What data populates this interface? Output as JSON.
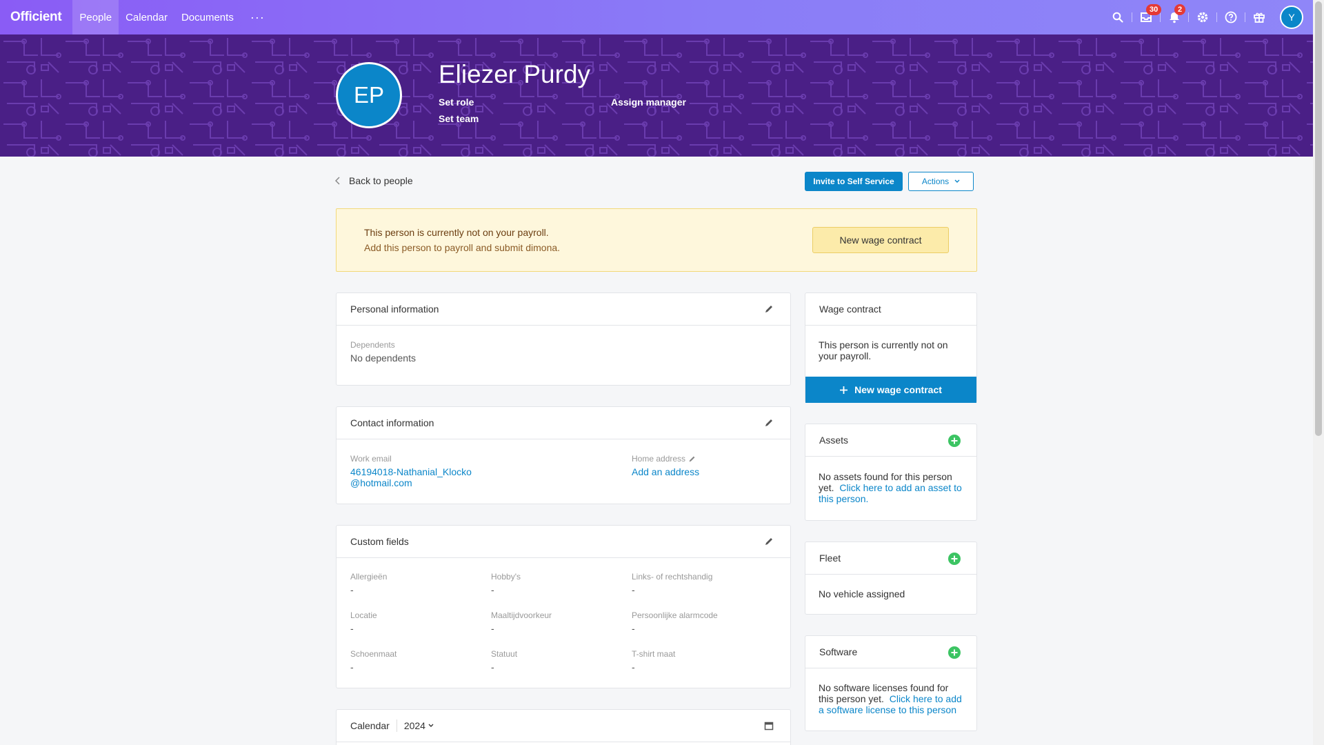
{
  "nav": {
    "logo": "Officient",
    "items": [
      {
        "label": "People",
        "active": true
      },
      {
        "label": "Calendar",
        "active": false
      },
      {
        "label": "Documents",
        "active": false
      }
    ],
    "more": "···",
    "icons": [
      "search-icon",
      "inbox-icon",
      "bell-icon",
      "gear-icon",
      "help-icon",
      "gift-icon"
    ],
    "inbox_badge": "30",
    "bell_badge": "2",
    "user_initial": "Y"
  },
  "profile": {
    "initials": "EP",
    "name": "Eliezer Purdy",
    "set_role": "Set role",
    "set_team": "Set team",
    "assign_manager": "Assign manager"
  },
  "toolbar": {
    "back": "Back to people",
    "invite": "Invite to Self Service",
    "actions": "Actions"
  },
  "alert": {
    "title": "This person is currently not on your payroll.",
    "subtitle": "Add this person to payroll and submit dimona.",
    "button": "New wage contract"
  },
  "personal": {
    "title": "Personal information",
    "dependents_label": "Dependents",
    "dependents_value": "No dependents"
  },
  "contact": {
    "title": "Contact information",
    "work_email_label": "Work email",
    "work_email_line1": "46194018-Nathanial_Klocko",
    "work_email_line2": "@hotmail.com",
    "home_address_label": "Home address",
    "home_address_value": "Add an address"
  },
  "custom": {
    "title": "Custom fields",
    "fields": [
      {
        "label": "Allergieën",
        "value": "-"
      },
      {
        "label": "Hobby's",
        "value": "-"
      },
      {
        "label": "Links- of rechtshandig",
        "value": "-"
      },
      {
        "label": "Locatie",
        "value": "-"
      },
      {
        "label": "Maaltijdvoorkeur",
        "value": "-"
      },
      {
        "label": "Persoonlijke alarmcode",
        "value": "-"
      },
      {
        "label": "Schoenmaat",
        "value": "-"
      },
      {
        "label": "Statuut",
        "value": "-"
      },
      {
        "label": "T-shirt maat",
        "value": "-"
      }
    ]
  },
  "calendar": {
    "title": "Calendar",
    "year": "2024"
  },
  "wage": {
    "title": "Wage contract",
    "text_line1": "This person is currently not on",
    "text_line2": "your payroll.",
    "button": "New wage contract"
  },
  "assets": {
    "title": "Assets",
    "text_line1": "No assets found for this person",
    "text_line2_prefix": "yet.",
    "link_line2": "Click here to add an asset to",
    "link_line3": "this person."
  },
  "fleet": {
    "title": "Fleet",
    "text": "No vehicle assigned"
  },
  "software": {
    "title": "Software",
    "text_line1": "No software licenses found for",
    "text_line2_prefix": "this person yet.",
    "link_line2": "Click here to add",
    "link_line3": "a software license to this person"
  },
  "colors": {
    "primary": "#0b86c9",
    "nav_gradient_start": "#8a5cf5",
    "banner": "#4a1f86",
    "alert_bg": "#fef7dc",
    "green_plus": "#3cc463"
  }
}
